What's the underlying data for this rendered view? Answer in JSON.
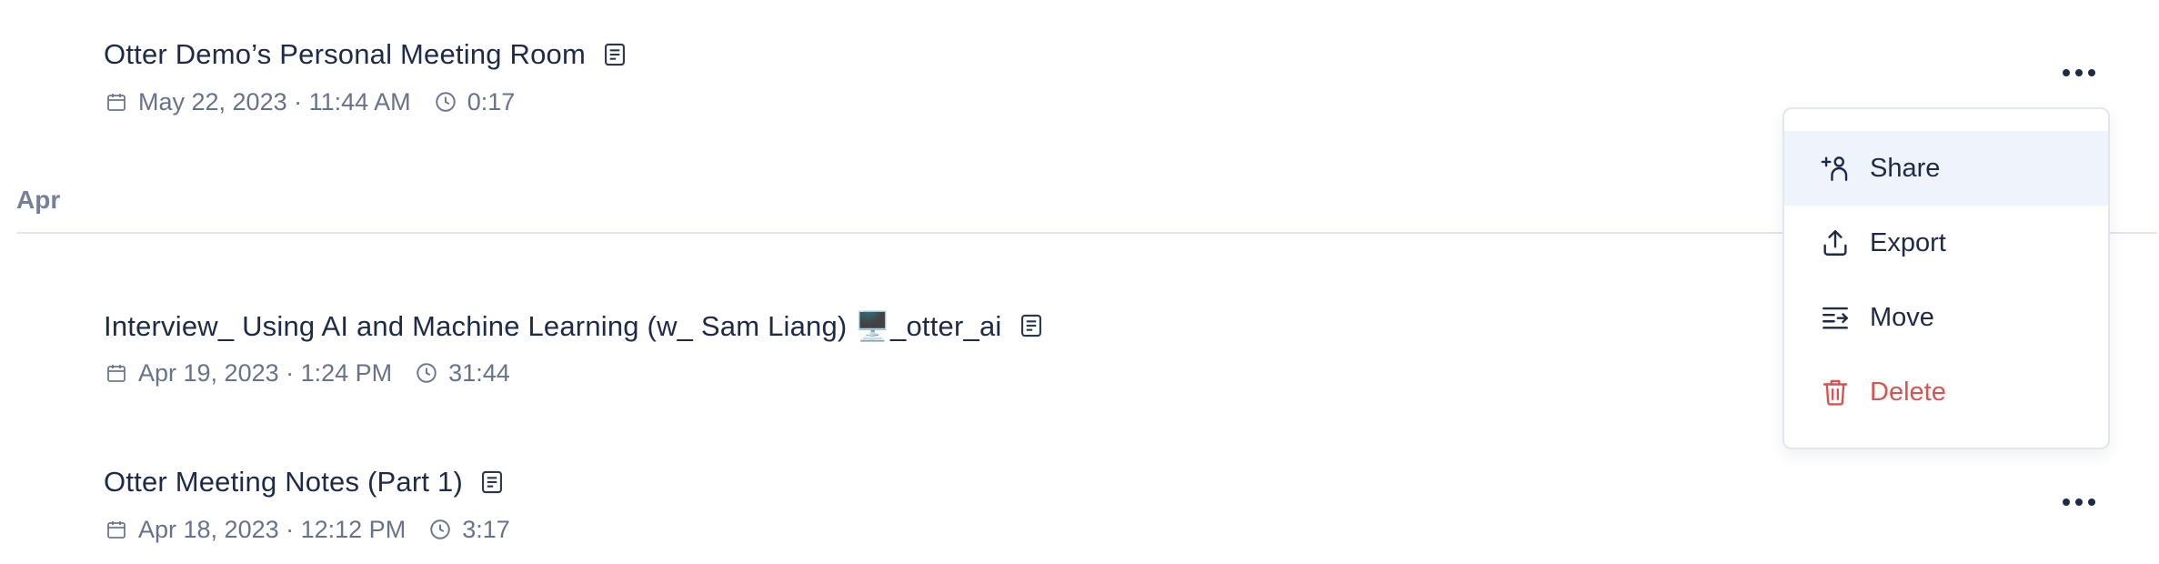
{
  "conversations": [
    {
      "title": "Otter Demo’s Personal Meeting Room",
      "date": "May 22, 2023 · 11:44 AM",
      "duration": "0:17"
    },
    {
      "title": "Interview_ Using AI and Machine Learning (w_ Sam Liang) 🖥️_otter_ai",
      "date": "Apr 19, 2023 · 1:24 PM",
      "duration": "31:44"
    },
    {
      "title": "Otter Meeting Notes (Part 1)",
      "date": "Apr 18, 2023 · 12:12 PM",
      "duration": "3:17"
    }
  ],
  "month_header": "Apr",
  "context_menu": {
    "items": [
      {
        "label": "Share",
        "icon": "add-person-icon",
        "state": "hovered"
      },
      {
        "label": "Export",
        "icon": "upload-icon"
      },
      {
        "label": "Move",
        "icon": "move-list-icon"
      },
      {
        "label": "Delete",
        "icon": "trash-icon",
        "color": "#d9534f"
      }
    ]
  },
  "colors": {
    "title_text": "#1d2b48",
    "meta_text": "#66738a",
    "menu_hover_bg": "#eef3fc",
    "danger": "#d9534f",
    "divider": "#e3e7ee"
  }
}
